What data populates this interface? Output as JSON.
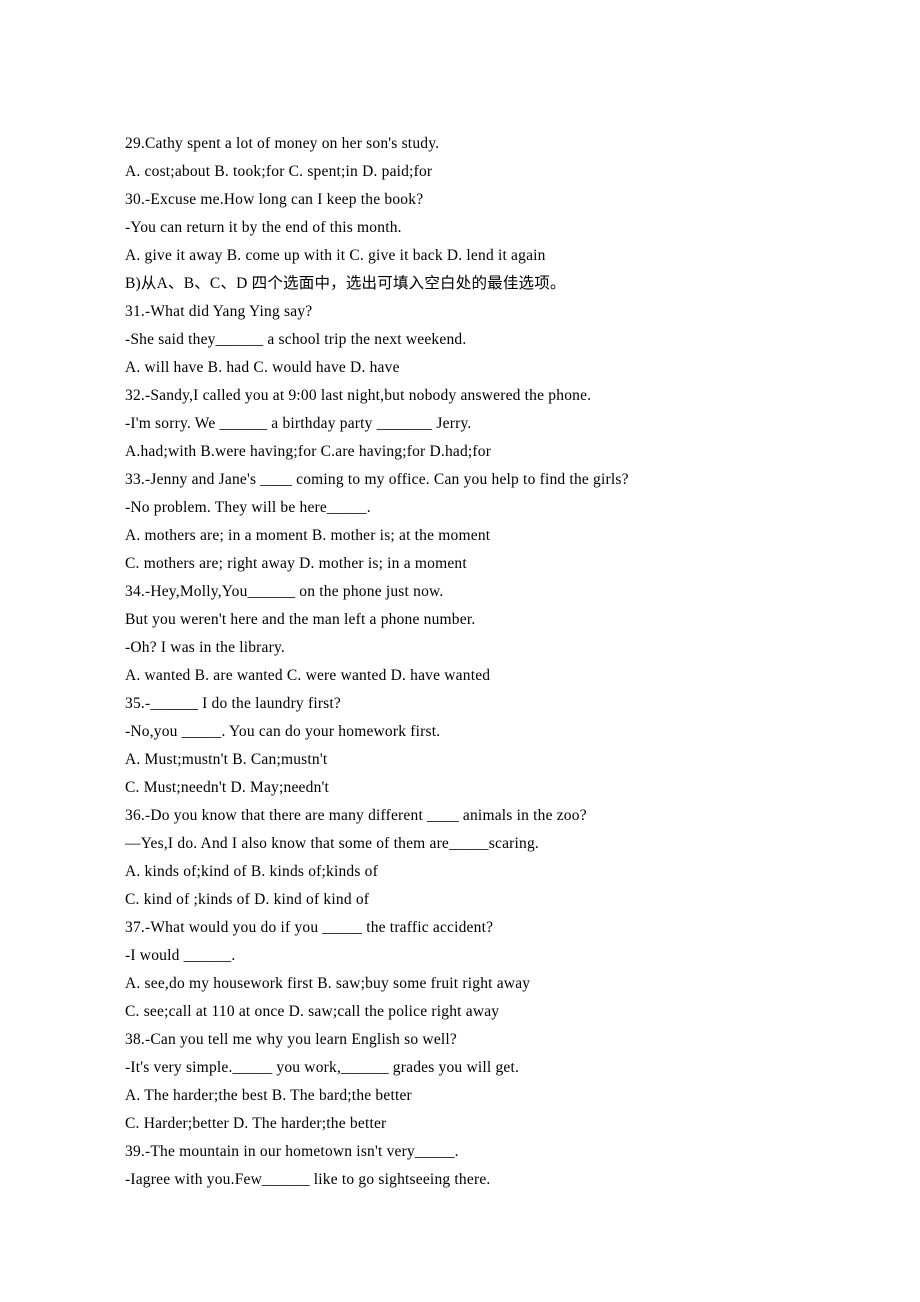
{
  "lines": [
    "29.Cathy spent a lot of money on her son's study.",
    "A. cost;about B. took;for C. spent;in D. paid;for",
    "30.-Excuse me.How long can I keep the book?",
    "-You can return it by the end of this month.",
    "A. give it away B. come up with it C. give it back D. lend it again",
    "B)从A、B、C、D 四个选面中，选出可填入空白处的最佳选项。",
    "31.-What did Yang Ying say?",
    "-She said they______ a school trip the next weekend.",
    "A. will have B. had C. would have D. have",
    "32.-Sandy,I called you at 9:00 last night,but nobody answered the phone.",
    "-I'm sorry. We ______ a birthday party _______ Jerry.",
    "A.had;with B.were having;for C.are having;for D.had;for",
    "33.-Jenny and Jane's ____ coming to my office. Can you help to find the girls?",
    "-No problem. They will be here_____.",
    "A. mothers are; in a moment B. mother is; at the moment",
    "C. mothers are; right away D. mother is; in a moment",
    "34.-Hey,Molly,You______ on the phone just now.",
    "But you weren't here and the man left a phone number.",
    "-Oh? I was in the library.",
    "A. wanted B. are wanted C. were wanted D. have wanted",
    "35.-______ I do the laundry first?",
    "-No,you _____. You can do your homework first.",
    "A. Must;mustn't B. Can;mustn't",
    "C. Must;needn't D. May;needn't",
    "36.-Do you know that there are many different ____ animals in the zoo?",
    "—Yes,I do. And I also know that some of them are_____scaring.",
    "A. kinds of;kind of B. kinds of;kinds of",
    "C. kind of ;kinds of D. kind of kind of",
    "37.-What would you do if you _____ the traffic accident?",
    "-I would ______.",
    "A. see,do my housework first B. saw;buy some fruit right away",
    "C. see;call at 110 at once D. saw;call the police right away",
    "38.-Can you tell me why you learn English so well?",
    "-It's very simple._____ you work,______ grades you will get.",
    "A. The harder;the best B. The bard;the better",
    "C. Harder;better D. The harder;the better",
    "39.-The mountain in our hometown isn't very_____.",
    "-Iagree with you.Few______ like to go sightseeing there."
  ]
}
